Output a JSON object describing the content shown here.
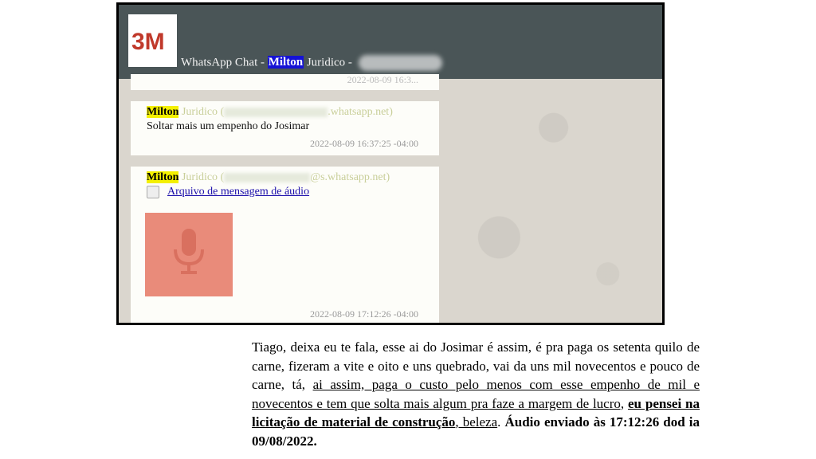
{
  "logo": {
    "text": "3M",
    "color": "#c0392b"
  },
  "title_bar": {
    "prefix": "WhatsApp Chat - ",
    "name": "Milton",
    "suffix": " Juridico - "
  },
  "messages": [
    {
      "partial": true,
      "timestamp": "2022-08-09 16:3..."
    },
    {
      "sender_name": "Milton",
      "sender_rest": " Juridico (",
      "sender_domain": ".whatsapp.net)",
      "text": "Soltar mais um empenho do Josimar",
      "timestamp": "2022-08-09 16:37:25 -04:00"
    },
    {
      "sender_name": "Milton",
      "sender_rest": " Juridico (",
      "sender_domain": "@s.whatsapp.net)",
      "attachment_label": "Arquivo de mensagem de áudio",
      "attachment_icon": "microphone-icon",
      "timestamp": "2022-08-09 17:12:26 -04:00"
    }
  ],
  "transcript": {
    "part1": "Tiago, deixa eu te fala, esse ai do Josimar é assim, é pra paga os setenta quilo de carne, fizeram a vite e oito e uns quebrado, vai da uns mil novecentos e pouco de carne, tá, ",
    "part2_underlined": "ai assim, paga o custo pelo menos com esse empenho de mil e novecentos e tem que solta mais algum pra faze a margem de lucro,",
    "part3_space": " ",
    "part4_bold_underlined": "eu pensei na licitação de material de construção",
    "part5_underlined": ", beleza",
    "part6": ". ",
    "part7_bold": "Áudio enviado às 17:12:26 dod ia 09/08/2022."
  }
}
